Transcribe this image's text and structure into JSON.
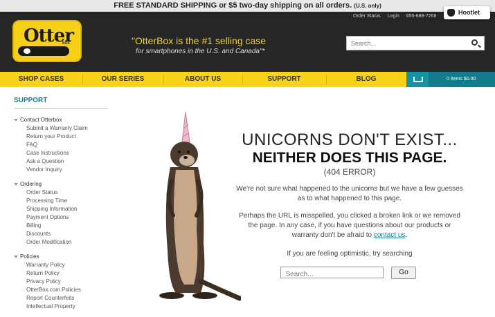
{
  "promo": {
    "text": "FREE STANDARD SHIPPING or $5 two-day shipping on all orders.",
    "note": "(U.S. only)"
  },
  "header": {
    "logo_text": "Otter",
    "logo_sub": "BOX",
    "tagline_main": "\"OtterBox is the #1 selling case",
    "tagline_sub": "for smartphones in the U.S. and Canada\"*",
    "util_links": [
      "Order Status",
      "Login",
      "855-688-7268"
    ],
    "search_placeholder": "Search..."
  },
  "hootlet": {
    "label": "Hootlet"
  },
  "nav": {
    "items": [
      "SHOP CASES",
      "OUR SERIES",
      "ABOUT US",
      "SUPPORT",
      "BLOG"
    ]
  },
  "cart": {
    "label": "0 Items $0.00"
  },
  "sidebar": {
    "title": "SUPPORT",
    "groups": [
      {
        "title": "Contact Otterbox",
        "items": [
          "Submit a Warranty Claim",
          "Return your Product",
          "FAQ",
          "Case Instructions",
          "Ask a Question",
          "Vendor Inquiry"
        ]
      },
      {
        "title": "Ordering",
        "items": [
          "Order Status",
          "Processing Time",
          "Shipping Information",
          "Payment Options",
          "Billing",
          "Discounts",
          "Order Modification"
        ]
      },
      {
        "title": "Policies",
        "items": [
          "Warranty Policy",
          "Return Policy",
          "Privacy Policy",
          "OtterBox.com Policies",
          "Report Counterfeits",
          "Intellectual Property"
        ]
      }
    ]
  },
  "error": {
    "heading1": "UNICORNS DON'T EXIST...",
    "heading2": "NEITHER DOES THIS PAGE.",
    "code": "(404 ERROR)",
    "para1": "We're not sure what happened to the unicorns but we have a few guesses as to what happened to this page.",
    "para2_pre": "Perhaps the URL is misspelled, you clicked a broken link or we removed the page. In any case, if you have questions about our products or warranty don't be afraid to",
    "para2_link": "contact us",
    "para2_post": ".",
    "try_text": "If you are feeling optimistic, try searching",
    "search_placeholder": "Search...",
    "go_label": "Go"
  },
  "colors": {
    "yellow": "#f8d31a",
    "teal": "#137c8a",
    "dark": "#262626"
  }
}
